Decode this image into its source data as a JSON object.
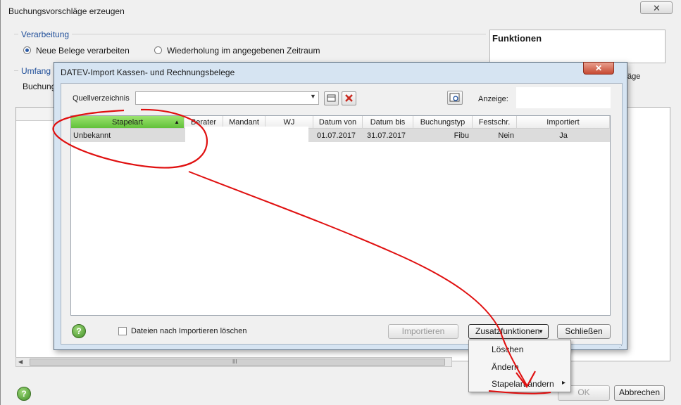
{
  "background_window": {
    "title": "Buchungsvorschläge erzeugen",
    "close_glyph": "✕",
    "group_processing": "Verarbeitung",
    "radio_new": "Neue Belege verarbeiten",
    "radio_repeat": "Wiederholung im angegebenen Zeitraum",
    "group_scope": "Umfang",
    "scope_label": "Buchung",
    "functions_title": "Funktionen",
    "functions_fragment": "äge",
    "scroll_grip": "III",
    "ok_label": "OK",
    "cancel_label": "Abbrechen",
    "help_glyph": "?"
  },
  "dialog": {
    "title": "DATEV-Import Kassen- und Rechnungsbelege",
    "close_glyph": "✕",
    "source_label": "Quellverzeichnis",
    "source_value": "",
    "display_label": "Anzeige:",
    "display_value": "",
    "columns": [
      "Stapelart",
      "Berater",
      "Mandant",
      "WJ",
      "Datum von",
      "Datum bis",
      "Buchungstyp",
      "Festschr.",
      "Importiert"
    ],
    "rows": [
      {
        "stapelart": "Unbekannt",
        "berater": "",
        "mandant": "",
        "wj": "",
        "datum_von": "01.07.2017",
        "datum_bis": "31.07.2017",
        "buchungstyp": "Fibu",
        "festschr": "Nein",
        "importiert": "Ja"
      }
    ],
    "delete_after_import_label": "Dateien nach Importieren löschen",
    "import_label": "Importieren",
    "extra_functions_label": "Zusatzfunktionen",
    "close_label": "Schließen",
    "help_glyph": "?"
  },
  "context_menu": {
    "items": [
      "Löschen",
      "Ändern",
      "Stapelart ändern"
    ],
    "submenu_arrow": "▸"
  },
  "colors": {
    "sorted_header": "#62c13a",
    "dialog_frame": "#d6e4f2",
    "annotation": "#e01010"
  }
}
